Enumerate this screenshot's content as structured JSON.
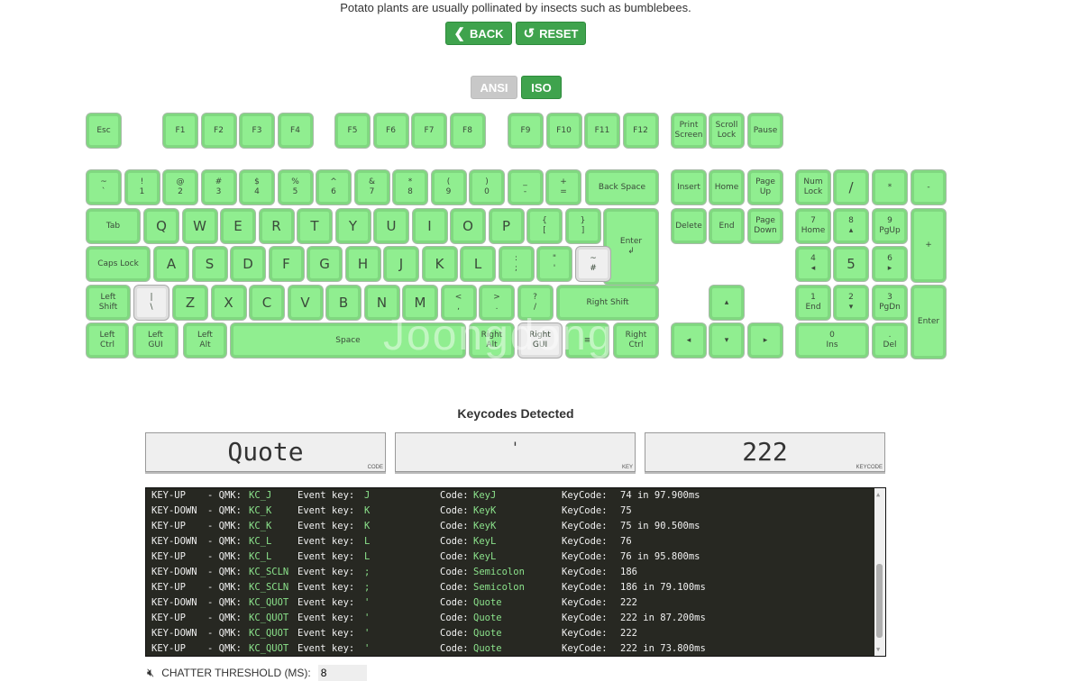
{
  "fact": "Potato plants are usually pollinated by insects such as bumblebees.",
  "buttons": {
    "back": "BACK",
    "reset": "RESET"
  },
  "layout_toggle": {
    "ansi": "ANSI",
    "iso": "ISO",
    "selected": "ISO"
  },
  "colors": {
    "key": "#90ee90",
    "pressed": "#efefef",
    "button": "#3fa34d",
    "log_bg": "#272822",
    "log_value": "#8be28b"
  },
  "keys": [
    {
      "t": "Esc"
    },
    {
      "t": "F1"
    },
    {
      "t": "F2"
    },
    {
      "t": "F3"
    },
    {
      "t": "F4"
    },
    {
      "t": "F5"
    },
    {
      "t": "F6"
    },
    {
      "t": "F7"
    },
    {
      "t": "F8"
    },
    {
      "t": "F9"
    },
    {
      "t": "F10"
    },
    {
      "t": "F11"
    },
    {
      "t": "F12"
    },
    {
      "t": "Print",
      "b": "Screen"
    },
    {
      "t": "Scroll",
      "b": "Lock"
    },
    {
      "t": "Pause"
    },
    {
      "t": "~",
      "b": "`"
    },
    {
      "t": "!",
      "b": "1"
    },
    {
      "t": "@",
      "b": "2"
    },
    {
      "t": "#",
      "b": "3"
    },
    {
      "t": "$",
      "b": "4"
    },
    {
      "t": "%",
      "b": "5"
    },
    {
      "t": "^",
      "b": "6"
    },
    {
      "t": "&",
      "b": "7"
    },
    {
      "t": "*",
      "b": "8"
    },
    {
      "t": "(",
      "b": "9"
    },
    {
      "t": ")",
      "b": "0"
    },
    {
      "t": "_",
      "b": "-"
    },
    {
      "t": "+",
      "b": "="
    },
    {
      "t": "Back Space"
    },
    {
      "t": "Insert"
    },
    {
      "t": "Home"
    },
    {
      "t": "Page",
      "b": "Up"
    },
    {
      "t": "Num",
      "b": "Lock"
    },
    {
      "t": "/"
    },
    {
      "t": "*"
    },
    {
      "t": "-"
    },
    {
      "t": "Tab"
    },
    {
      "t": "Q"
    },
    {
      "t": "W"
    },
    {
      "t": "E"
    },
    {
      "t": "R"
    },
    {
      "t": "T"
    },
    {
      "t": "Y"
    },
    {
      "t": "U"
    },
    {
      "t": "I"
    },
    {
      "t": "O"
    },
    {
      "t": "P"
    },
    {
      "t": "{",
      "b": "["
    },
    {
      "t": "}",
      "b": "]"
    },
    {
      "t": "Enter",
      "b": "↲"
    },
    {
      "t": "Delete"
    },
    {
      "t": "End"
    },
    {
      "t": "Page",
      "b": "Down"
    },
    {
      "t": "7",
      "b": "Home"
    },
    {
      "t": "8",
      "b": "▴"
    },
    {
      "t": "9",
      "b": "PgUp"
    },
    {
      "t": "+"
    },
    {
      "t": "Caps Lock"
    },
    {
      "t": "A"
    },
    {
      "t": "S"
    },
    {
      "t": "D"
    },
    {
      "t": "F"
    },
    {
      "t": "G"
    },
    {
      "t": "H"
    },
    {
      "t": "J"
    },
    {
      "t": "K"
    },
    {
      "t": "L"
    },
    {
      "t": ":",
      "b": ";"
    },
    {
      "t": "\"",
      "b": "'"
    },
    {
      "t": "~",
      "b": "#",
      "pressed": true
    },
    {
      "t": "4",
      "b": "◂"
    },
    {
      "t": "5"
    },
    {
      "t": "6",
      "b": "▸"
    },
    {
      "t": "Left",
      "b": "Shift"
    },
    {
      "t": "|",
      "b": "\\",
      "pressed": true
    },
    {
      "t": "Z"
    },
    {
      "t": "X"
    },
    {
      "t": "C"
    },
    {
      "t": "V"
    },
    {
      "t": "B"
    },
    {
      "t": "N"
    },
    {
      "t": "M"
    },
    {
      "t": "<",
      "b": ","
    },
    {
      "t": ">",
      "b": "."
    },
    {
      "t": "?",
      "b": "/"
    },
    {
      "t": "Right Shift"
    },
    {
      "t": "▴"
    },
    {
      "t": "1",
      "b": "End"
    },
    {
      "t": "2",
      "b": "▾"
    },
    {
      "t": "3",
      "b": "PgDn"
    },
    {
      "t": "Enter"
    },
    {
      "t": "Left",
      "b": "Ctrl"
    },
    {
      "t": "Left",
      "b": "GUI"
    },
    {
      "t": "Left",
      "b": "Alt"
    },
    {
      "t": "Space"
    },
    {
      "t": "Right",
      "b": "Alt"
    },
    {
      "t": "Right",
      "b": "GUI",
      "pressed": true
    },
    {
      "t": "≡"
    },
    {
      "t": "Right",
      "b": "Ctrl"
    },
    {
      "t": "◂"
    },
    {
      "t": "▾"
    },
    {
      "t": "▸"
    },
    {
      "t": "0",
      "b": "Ins"
    },
    {
      "t": ".",
      "b": "Del"
    }
  ],
  "detected": {
    "title": "Keycodes Detected",
    "code": {
      "value": "Quote",
      "label": "CODE"
    },
    "key": {
      "value": "'",
      "label": "KEY"
    },
    "keycode": {
      "value": "222",
      "label": "KEYCODE"
    }
  },
  "log": [
    {
      "ev": "KEY-UP  ",
      "qmk": "KC_J",
      "key": "J",
      "code": "KeyJ",
      "kc": "74 in 97.900ms"
    },
    {
      "ev": "KEY-DOWN",
      "qmk": "KC_K",
      "key": "K",
      "code": "KeyK",
      "kc": "75"
    },
    {
      "ev": "KEY-UP  ",
      "qmk": "KC_K",
      "key": "K",
      "code": "KeyK",
      "kc": "75 in 90.500ms"
    },
    {
      "ev": "KEY-DOWN",
      "qmk": "KC_L",
      "key": "L",
      "code": "KeyL",
      "kc": "76"
    },
    {
      "ev": "KEY-UP  ",
      "qmk": "KC_L",
      "key": "L",
      "code": "KeyL",
      "kc": "76 in 95.800ms"
    },
    {
      "ev": "KEY-DOWN",
      "qmk": "KC_SCLN",
      "key": ";",
      "code": "Semicolon",
      "kc": "186"
    },
    {
      "ev": "KEY-UP  ",
      "qmk": "KC_SCLN",
      "key": ";",
      "code": "Semicolon",
      "kc": "186 in 79.100ms"
    },
    {
      "ev": "KEY-DOWN",
      "qmk": "KC_QUOT",
      "key": "'",
      "code": "Quote",
      "kc": "222"
    },
    {
      "ev": "KEY-UP  ",
      "qmk": "KC_QUOT",
      "key": "'",
      "code": "Quote",
      "kc": "222 in 87.200ms"
    },
    {
      "ev": "KEY-DOWN",
      "qmk": "KC_QUOT",
      "key": "'",
      "code": "Quote",
      "kc": "222"
    },
    {
      "ev": "KEY-UP  ",
      "qmk": "KC_QUOT",
      "key": "'",
      "code": "Quote",
      "kc": "222 in 73.800ms"
    }
  ],
  "log_labels": {
    "qmk": "- QMK:",
    "event": "Event key:",
    "code": "Code:",
    "keycode": "KeyCode:"
  },
  "chatter": {
    "label": "CHATTER THRESHOLD (MS):",
    "value": "8"
  },
  "watermark": "Joongdong"
}
